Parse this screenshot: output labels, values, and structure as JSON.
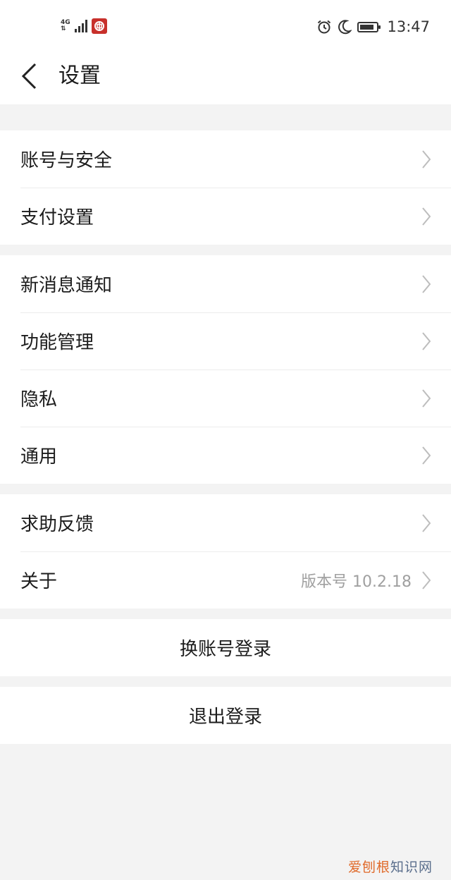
{
  "status_bar": {
    "network": "4G",
    "time": "13:47",
    "battery_level": 0.85,
    "icons": [
      "signal-icon",
      "bank-app-icon",
      "alarm-icon",
      "moon-icon",
      "battery-icon"
    ]
  },
  "header": {
    "back_icon": "chevron-left-icon",
    "title": "设置"
  },
  "groups": [
    {
      "items": [
        {
          "label": "账号与安全"
        },
        {
          "label": "支付设置"
        }
      ]
    },
    {
      "items": [
        {
          "label": "新消息通知"
        },
        {
          "label": "功能管理"
        },
        {
          "label": "隐私"
        },
        {
          "label": "通用"
        }
      ]
    },
    {
      "items": [
        {
          "label": "求助反馈"
        },
        {
          "label": "关于",
          "value": "版本号 10.2.18"
        }
      ]
    }
  ],
  "actions": {
    "switch_account": "换账号登录",
    "logout": "退出登录"
  },
  "watermark": {
    "part1": "爱刨根",
    "part2": "知识网"
  },
  "colors": {
    "background": "#f3f3f3",
    "surface": "#ffffff",
    "secondary_text": "#a0a0a0",
    "brand_red": "#c8302b"
  }
}
